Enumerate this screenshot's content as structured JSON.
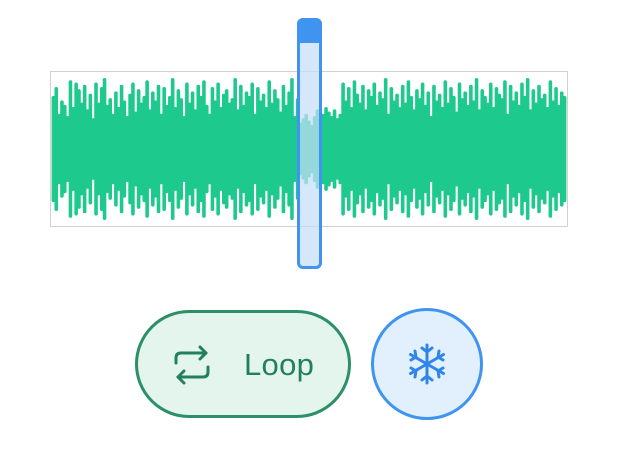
{
  "waveform": {
    "color": "#1ec98e",
    "amplitudes": [
      0.46,
      0.54,
      0.3,
      0.42,
      0.38,
      0.28,
      0.6,
      0.36,
      0.58,
      0.52,
      0.4,
      0.56,
      0.34,
      0.48,
      0.26,
      0.58,
      0.4,
      0.54,
      0.62,
      0.38,
      0.44,
      0.3,
      0.5,
      0.36,
      0.56,
      0.42,
      0.28,
      0.48,
      0.58,
      0.32,
      0.52,
      0.4,
      0.46,
      0.6,
      0.34,
      0.5,
      0.42,
      0.56,
      0.3,
      0.54,
      0.38,
      0.46,
      0.62,
      0.36,
      0.52,
      0.44,
      0.28,
      0.58,
      0.4,
      0.5,
      0.34,
      0.56,
      0.46,
      0.6,
      0.38,
      0.3,
      0.54,
      0.42,
      0.58,
      0.36,
      0.48,
      0.52,
      0.4,
      0.44,
      0.62,
      0.34,
      0.56,
      0.38,
      0.5,
      0.46,
      0.58,
      0.3,
      0.54,
      0.42,
      0.48,
      0.36,
      0.6,
      0.4,
      0.52,
      0.44,
      0.32,
      0.56,
      0.38,
      0.5,
      0.62,
      0.28,
      0.44,
      0.22,
      0.26,
      0.3,
      0.24,
      0.2,
      0.28,
      0.34,
      0.26,
      0.3,
      0.36,
      0.32,
      0.28,
      0.34,
      0.26,
      0.3,
      0.58,
      0.42,
      0.54,
      0.36,
      0.6,
      0.48,
      0.4,
      0.56,
      0.34,
      0.52,
      0.46,
      0.58,
      0.38,
      0.5,
      0.44,
      0.62,
      0.3,
      0.54,
      0.42,
      0.48,
      0.36,
      0.56,
      0.4,
      0.6,
      0.46,
      0.34,
      0.52,
      0.44,
      0.58,
      0.38,
      0.5,
      0.28,
      0.56,
      0.42,
      0.48,
      0.36,
      0.6,
      0.4,
      0.54,
      0.46,
      0.32,
      0.58,
      0.44,
      0.5,
      0.38,
      0.56,
      0.42,
      0.62,
      0.34,
      0.52,
      0.46,
      0.4,
      0.58,
      0.36,
      0.54,
      0.48,
      0.44,
      0.6,
      0.3,
      0.56,
      0.42,
      0.5,
      0.38,
      0.58,
      0.46,
      0.62,
      0.34,
      0.52,
      0.4,
      0.56,
      0.44,
      0.48,
      0.36,
      0.6,
      0.42,
      0.54,
      0.38,
      0.5,
      0.46
    ]
  },
  "playhead": {
    "position": 0.5,
    "color": "#3f94f0"
  },
  "loop_button": {
    "label": "Loop",
    "icon": "repeat-arrows-icon",
    "color": "#23805c",
    "background": "#e3f5ec"
  },
  "freeze_button": {
    "icon": "snowflake-icon",
    "color": "#3f94f0",
    "background": "#e2f0fd"
  }
}
